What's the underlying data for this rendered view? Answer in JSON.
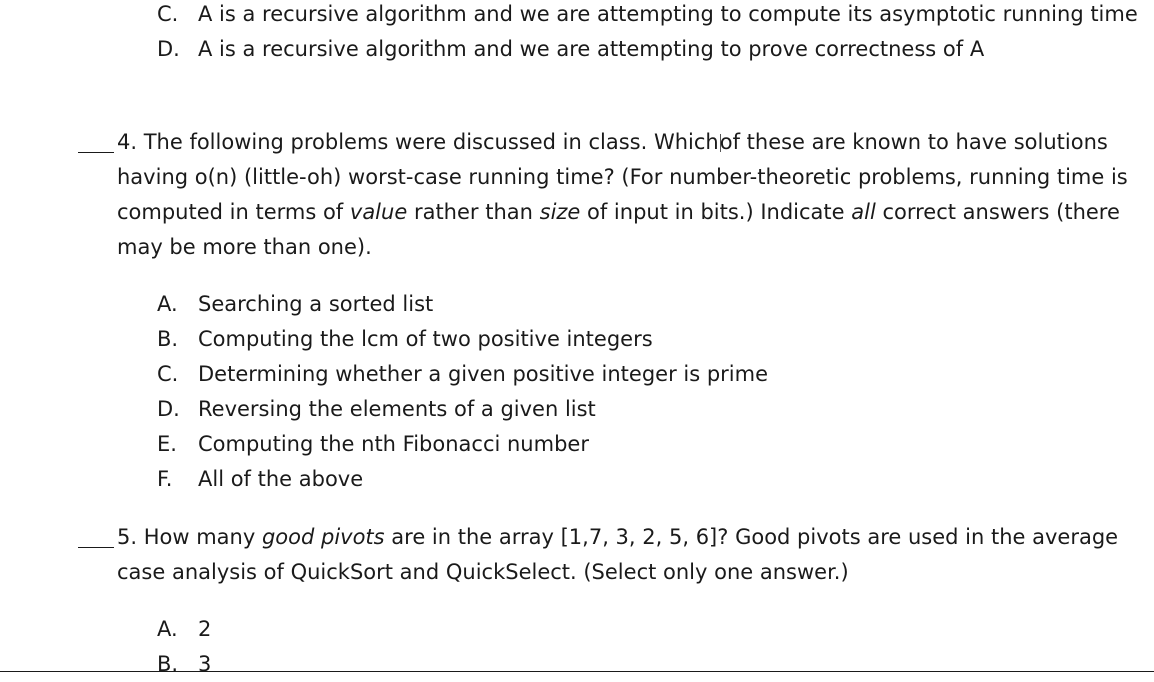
{
  "q3_options_tail": [
    {
      "letter": "C.",
      "text": "A is a recursive algorithm and we are attempting to compute its asymptotic running time"
    },
    {
      "letter": "D.",
      "text": "A is a recursive algorithm and we are attempting to prove correctness of A"
    }
  ],
  "q4": {
    "line1_a": "4. The following problems were discussed in class. Which",
    "line1_b": "of these are known to have solutions",
    "line2": "having o(n) (little-oh) worst-case running time? (For number-theoretic problems, running time is",
    "line3_a": "computed in terms of ",
    "line3_em1": "value",
    "line3_b": " rather than ",
    "line3_em2": "size",
    "line3_c": " of input in bits.) Indicate ",
    "line3_em3": "all",
    "line3_d": " correct answers (there",
    "line4": "may be more than one).",
    "options": [
      {
        "letter": "A.",
        "text": "Searching a sorted list"
      },
      {
        "letter": "B.",
        "text": "Computing the lcm of two positive integers"
      },
      {
        "letter": "C.",
        "text": "Determining whether a given positive integer is prime"
      },
      {
        "letter": "D.",
        "text": "Reversing the elements of a given list"
      },
      {
        "letter": "E.",
        "text": "Computing the nth Fibonacci number"
      },
      {
        "letter": "F.",
        "text": "All of the above"
      }
    ]
  },
  "q5": {
    "line1_a": "5. How many ",
    "line1_em": "good pivots",
    "line1_b": " are in the array [1,7, 3, 2, 5, 6]? Good pivots are used in the average",
    "line2": "case analysis of QuickSort and QuickSelect. (Select only one answer.)",
    "options": [
      {
        "letter": "A.",
        "text": "2"
      },
      {
        "letter": "B.",
        "text": "3"
      }
    ]
  }
}
